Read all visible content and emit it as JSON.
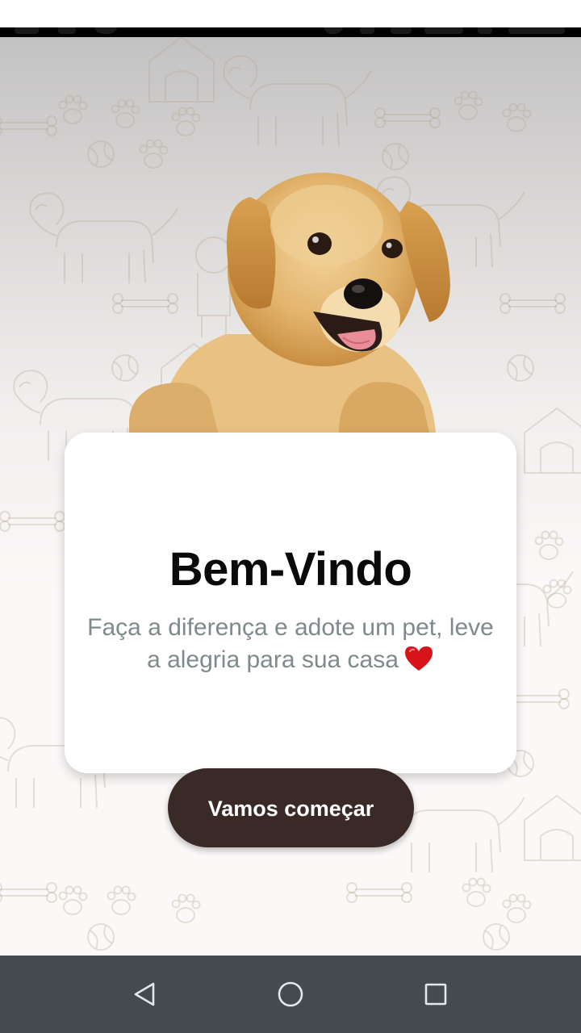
{
  "card": {
    "title": "Bem-Vindo",
    "subtitle": "Faça a diferença e adote um pet, leve a alegria para sua casa"
  },
  "cta": {
    "label": "Vamos começar"
  },
  "nav": {
    "back_icon": "triangle-back-icon",
    "home_icon": "circle-home-icon",
    "recents_icon": "square-recents-icon"
  },
  "colors": {
    "button_bg": "#3a2a27",
    "title": "#0a0a0a",
    "subtitle": "#7e8a8c",
    "nav_bar": "#434a50",
    "heart": "#d8141b"
  }
}
